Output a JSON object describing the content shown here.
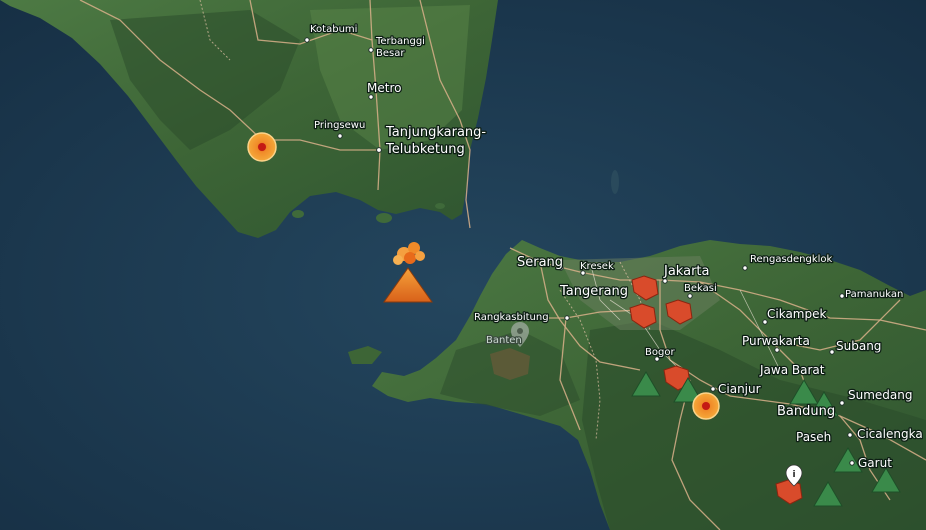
{
  "map": {
    "places": [
      {
        "id": "kotabumi",
        "label": "Kotabumi",
        "size": "s"
      },
      {
        "id": "terbanggi",
        "label": "Terbanggi",
        "size": "s"
      },
      {
        "id": "besar",
        "label": "Besar",
        "size": "s"
      },
      {
        "id": "metro",
        "label": "Metro",
        "size": "m"
      },
      {
        "id": "pringsewu",
        "label": "Pringsewu",
        "size": "s"
      },
      {
        "id": "tanjungkarang",
        "label": "Tanjungkarang-",
        "size": "l"
      },
      {
        "id": "telubketung",
        "label": "Telubketung",
        "size": "l"
      },
      {
        "id": "serang",
        "label": "Serang",
        "size": "l"
      },
      {
        "id": "kresek",
        "label": "Kresek",
        "size": "s"
      },
      {
        "id": "tangerang",
        "label": "Tangerang",
        "size": "l"
      },
      {
        "id": "jakarta",
        "label": "Jakarta",
        "size": "l"
      },
      {
        "id": "bekasi",
        "label": "Bekasi",
        "size": "s"
      },
      {
        "id": "rengasdengklok",
        "label": "Rengasdengklok",
        "size": "s"
      },
      {
        "id": "pamanukan",
        "label": "Pamanukan",
        "size": "s"
      },
      {
        "id": "rangkasbitung",
        "label": "Rangkasbitung",
        "size": "s"
      },
      {
        "id": "banten",
        "label": "Banten",
        "size": "s"
      },
      {
        "id": "cikampek",
        "label": "Cikampek",
        "size": "m"
      },
      {
        "id": "purwakarta",
        "label": "Purwakarta",
        "size": "m"
      },
      {
        "id": "subang",
        "label": "Subang",
        "size": "m"
      },
      {
        "id": "bogor",
        "label": "Bogor",
        "size": "s"
      },
      {
        "id": "jawabarat",
        "label": "Jawa Barat",
        "size": "m"
      },
      {
        "id": "cianjur",
        "label": "Cianjur",
        "size": "m"
      },
      {
        "id": "sumedang",
        "label": "Sumedang",
        "size": "m"
      },
      {
        "id": "bandung",
        "label": "Bandung",
        "size": "l"
      },
      {
        "id": "paseh",
        "label": "Paseh",
        "size": "m"
      },
      {
        "id": "cicalengka",
        "label": "Cicalengka",
        "size": "m"
      },
      {
        "id": "garut",
        "label": "Garut",
        "size": "m"
      }
    ],
    "markers": [
      {
        "id": "eq-lampung",
        "type": "earthquake"
      },
      {
        "id": "volcano-krakatau",
        "type": "erupting-volcano"
      },
      {
        "id": "banten-pin",
        "type": "location-pin"
      },
      {
        "id": "eq-cianjur",
        "type": "earthquake"
      },
      {
        "id": "info-pin",
        "type": "info-pin"
      }
    ],
    "colors": {
      "sea": "#1d3b52",
      "land": "#3f6a3a",
      "volcano": "#e8741c",
      "hazard": "#d94b2b",
      "mountain": "#3a8a4a",
      "road": "#d8b08a"
    }
  }
}
